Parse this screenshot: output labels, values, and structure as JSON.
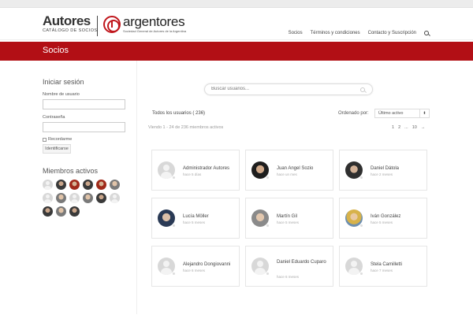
{
  "header": {
    "autores_brand": "Autores",
    "autores_sub": "CATÁLOGO DE SOCIOS",
    "argentores_brand": "argentores",
    "argentores_sub": "Sociedad General de Autores de la Argentina",
    "nav": [
      "Socios",
      "Términos y condiciones",
      "Contacto y Suscripción"
    ]
  },
  "page_title": "Socios",
  "sidebar": {
    "login_title": "Iniciar sesión",
    "username_label": "Nombre de usuario",
    "password_label": "Contraseña",
    "remember_label": "Recordarme",
    "login_button": "Identificarse",
    "members_title": "Miembros activos"
  },
  "main": {
    "search_placeholder": "Buscar usuarios...",
    "tab_all": "Todos los usuarios ( 236)",
    "order_label": "Ordenado por:",
    "order_selected": "Último activo",
    "viewing": "Viendo 1 - 24 de 236 miembros activos",
    "pager": [
      "1",
      "2",
      "...",
      "10",
      "→"
    ],
    "members": [
      {
        "name": "Administrador Autores",
        "meta": "hace 5 días"
      },
      {
        "name": "Juan Angel Sozio",
        "meta": "hace un mes"
      },
      {
        "name": "Daniel Dátola",
        "meta": "hace 2 meses"
      },
      {
        "name": "Lucía Möller",
        "meta": "hace 5 meses"
      },
      {
        "name": "Martín Gil",
        "meta": "hace 5 meses"
      },
      {
        "name": "Iván González",
        "meta": "hace 5 meses"
      },
      {
        "name": "Alejandro Dongiovanni",
        "meta": "hace 6 meses"
      },
      {
        "name": "Daniel Eduardo Cuparo",
        "meta": "hace 6 meses"
      },
      {
        "name": "Stela Camilletti",
        "meta": "hace 7 meses"
      }
    ]
  }
}
